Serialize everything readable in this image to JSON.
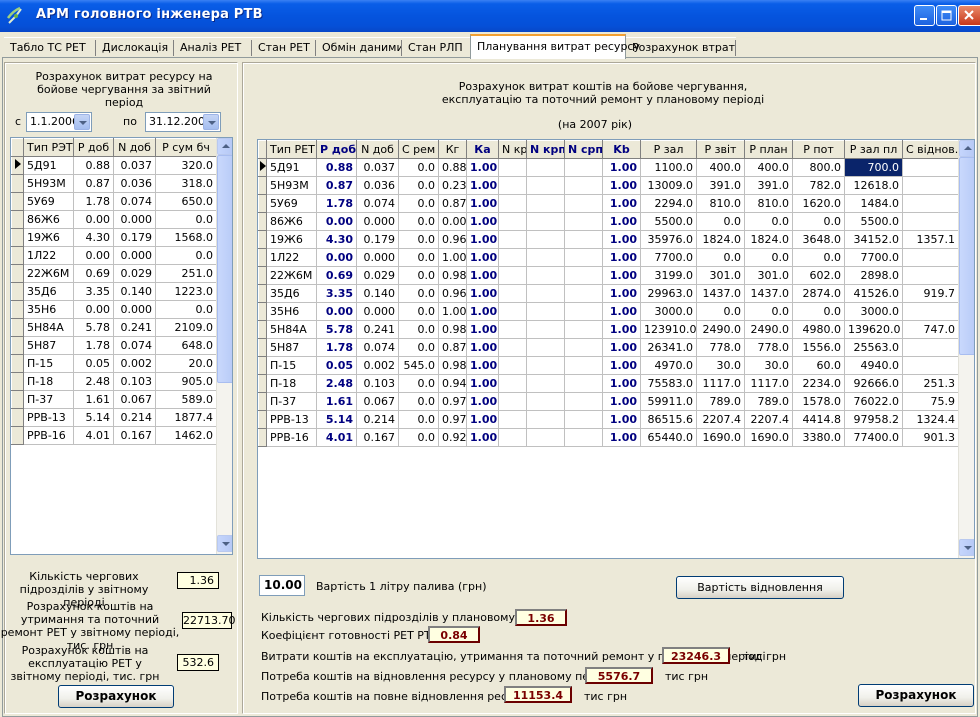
{
  "window": {
    "title": "АРМ головного інженера РТВ"
  },
  "tabs": [
    {
      "label": "Табло ТС РЕТ"
    },
    {
      "label": "Дислокація"
    },
    {
      "label": "Аналіз РЕТ"
    },
    {
      "label": "Стан РЕТ"
    },
    {
      "label": "Обмін даними"
    },
    {
      "label": "Стан РЛП"
    },
    {
      "label": "Планування витрат ресурсу"
    },
    {
      "label": "Розрахунок втрат"
    }
  ],
  "left": {
    "heading": "Розрахунок витрат ресурсу на бойове чергування за звітний період",
    "from_label": "с",
    "from_date": "1.1.2006",
    "to_label": "по",
    "to_date": "31.12.2006",
    "columns": [
      "Тип РЭТ",
      "Р доб",
      "N доб",
      "Р сум бч"
    ],
    "rows": [
      [
        "5Д91",
        "0.88",
        "0.037",
        "320.0"
      ],
      [
        "5Н93М",
        "0.87",
        "0.036",
        "318.0"
      ],
      [
        "5У69",
        "1.78",
        "0.074",
        "650.0"
      ],
      [
        "86Ж6",
        "0.00",
        "0.000",
        "0.0"
      ],
      [
        "19Ж6",
        "4.30",
        "0.179",
        "1568.0"
      ],
      [
        "1Л22",
        "0.00",
        "0.000",
        "0.0"
      ],
      [
        "22Ж6М",
        "0.69",
        "0.029",
        "251.0"
      ],
      [
        "35Д6",
        "3.35",
        "0.140",
        "1223.0"
      ],
      [
        "35Н6",
        "0.00",
        "0.000",
        "0.0"
      ],
      [
        "5Н84А",
        "5.78",
        "0.241",
        "2109.0"
      ],
      [
        "5Н87",
        "1.78",
        "0.074",
        "648.0"
      ],
      [
        "П-15",
        "0.05",
        "0.002",
        "20.0"
      ],
      [
        "П-18",
        "2.48",
        "0.103",
        "905.0"
      ],
      [
        "П-37",
        "1.61",
        "0.067",
        "589.0"
      ],
      [
        "РРВ-13",
        "5.14",
        "0.214",
        "1877.4"
      ],
      [
        "РРВ-16",
        "4.01",
        "0.167",
        "1462.0"
      ]
    ],
    "count_label": "Кількість чергових підрозділів у звітному періоді",
    "count_value": "1.36",
    "maint_label": "Розрахунок коштів на утримання та поточний ремонт РЕТ у звітному періоді, тис. грн",
    "maint_value": "22713.70",
    "oper_label": "Розрахунок коштів на експлуатацію РЕТ у звітному періоді, тис. грн",
    "oper_value": "532.6",
    "calc_button": "Розрахунок"
  },
  "right": {
    "heading": "Розрахунок витрат коштів на бойове чергування, експлуатацію та поточний ремонт у плановому періоді",
    "year": "(на 2007 рік)",
    "columns": [
      "Тип РЕТ",
      "Р доб",
      "N доб",
      "С рем",
      "Кг",
      "Ка",
      "N кр",
      "N крп",
      "N срп",
      "Kb",
      "Р зал",
      "Р звіт",
      "Р план",
      "Р пот",
      "Р зал пл",
      "С віднов."
    ],
    "rows": [
      [
        "5Д91",
        "0.88",
        "0.037",
        "0.0",
        "0.88",
        "1.00",
        "",
        "",
        "",
        "1.00",
        "1100.0",
        "400.0",
        "400.0",
        "800.0",
        "700.0",
        ""
      ],
      [
        "5Н93М",
        "0.87",
        "0.036",
        "0.0",
        "0.23",
        "1.00",
        "",
        "",
        "",
        "1.00",
        "13009.0",
        "391.0",
        "391.0",
        "782.0",
        "12618.0",
        ""
      ],
      [
        "5У69",
        "1.78",
        "0.074",
        "0.0",
        "0.87",
        "1.00",
        "",
        "",
        "",
        "1.00",
        "2294.0",
        "810.0",
        "810.0",
        "1620.0",
        "1484.0",
        ""
      ],
      [
        "86Ж6",
        "0.00",
        "0.000",
        "0.0",
        "0.00",
        "1.00",
        "",
        "",
        "",
        "1.00",
        "5500.0",
        "0.0",
        "0.0",
        "0.0",
        "5500.0",
        ""
      ],
      [
        "19Ж6",
        "4.30",
        "0.179",
        "0.0",
        "0.96",
        "1.00",
        "",
        "",
        "",
        "1.00",
        "35976.0",
        "1824.0",
        "1824.0",
        "3648.0",
        "34152.0",
        "1357.1"
      ],
      [
        "1Л22",
        "0.00",
        "0.000",
        "0.0",
        "1.00",
        "1.00",
        "",
        "",
        "",
        "1.00",
        "7700.0",
        "0.0",
        "0.0",
        "0.0",
        "7700.0",
        ""
      ],
      [
        "22Ж6М",
        "0.69",
        "0.029",
        "0.0",
        "0.98",
        "1.00",
        "",
        "",
        "",
        "1.00",
        "3199.0",
        "301.0",
        "301.0",
        "602.0",
        "2898.0",
        ""
      ],
      [
        "35Д6",
        "3.35",
        "0.140",
        "0.0",
        "0.96",
        "1.00",
        "",
        "",
        "",
        "1.00",
        "29963.0",
        "1437.0",
        "1437.0",
        "2874.0",
        "41526.0",
        "919.7"
      ],
      [
        "35Н6",
        "0.00",
        "0.000",
        "0.0",
        "1.00",
        "1.00",
        "",
        "",
        "",
        "1.00",
        "3000.0",
        "0.0",
        "0.0",
        "0.0",
        "3000.0",
        ""
      ],
      [
        "5Н84А",
        "5.78",
        "0.241",
        "0.0",
        "0.98",
        "1.00",
        "",
        "",
        "",
        "1.00",
        "123910.0",
        "2490.0",
        "2490.0",
        "4980.0",
        "139620.0",
        "747.0"
      ],
      [
        "5Н87",
        "1.78",
        "0.074",
        "0.0",
        "0.87",
        "1.00",
        "",
        "",
        "",
        "1.00",
        "26341.0",
        "778.0",
        "778.0",
        "1556.0",
        "25563.0",
        ""
      ],
      [
        "П-15",
        "0.05",
        "0.002",
        "545.0",
        "0.98",
        "1.00",
        "",
        "",
        "",
        "1.00",
        "4970.0",
        "30.0",
        "30.0",
        "60.0",
        "4940.0",
        ""
      ],
      [
        "П-18",
        "2.48",
        "0.103",
        "0.0",
        "0.94",
        "1.00",
        "",
        "",
        "",
        "1.00",
        "75583.0",
        "1117.0",
        "1117.0",
        "2234.0",
        "92666.0",
        "251.3"
      ],
      [
        "П-37",
        "1.61",
        "0.067",
        "0.0",
        "0.97",
        "1.00",
        "",
        "",
        "",
        "1.00",
        "59911.0",
        "789.0",
        "789.0",
        "1578.0",
        "76022.0",
        "75.9"
      ],
      [
        "РРВ-13",
        "5.14",
        "0.214",
        "0.0",
        "0.97",
        "1.00",
        "",
        "",
        "",
        "1.00",
        "86515.6",
        "2207.4",
        "2207.4",
        "4414.8",
        "97958.2",
        "1324.4"
      ],
      [
        "РРВ-16",
        "4.01",
        "0.167",
        "0.0",
        "0.92",
        "1.00",
        "",
        "",
        "",
        "1.00",
        "65440.0",
        "1690.0",
        "1690.0",
        "3380.0",
        "77400.0",
        "901.3"
      ]
    ],
    "fuel_value": "10.00",
    "fuel_label": "Вартість 1 літру палива (грн)",
    "restore_button": "Вартість відновлення",
    "count_label": "Кількість чергових підрозділів у плановому періоді",
    "count_value": "1.36",
    "ready_label": "Коефіцієнт готовності РЕТ РТВ",
    "ready_value": "0.84",
    "costs_label": "Витрати коштів на експлуатацію, утримання та поточний ремонт у плановому періоді",
    "costs_value": "23246.3",
    "costs_unit": "тис грн",
    "need_label": "Потреба коштів на відновлення ресурсу у плановому періоді",
    "need_value": "5576.7",
    "need_unit": "тис грн",
    "full_label": "Потреба коштів на повне відновлення ресурсу",
    "full_value": "11153.4",
    "full_unit": "тис грн",
    "calc_button": "Розрахунок"
  },
  "icons": {
    "app": "radar-icon",
    "minimize": "minimize-icon",
    "maximize": "maximize-icon",
    "close": "close-icon"
  }
}
